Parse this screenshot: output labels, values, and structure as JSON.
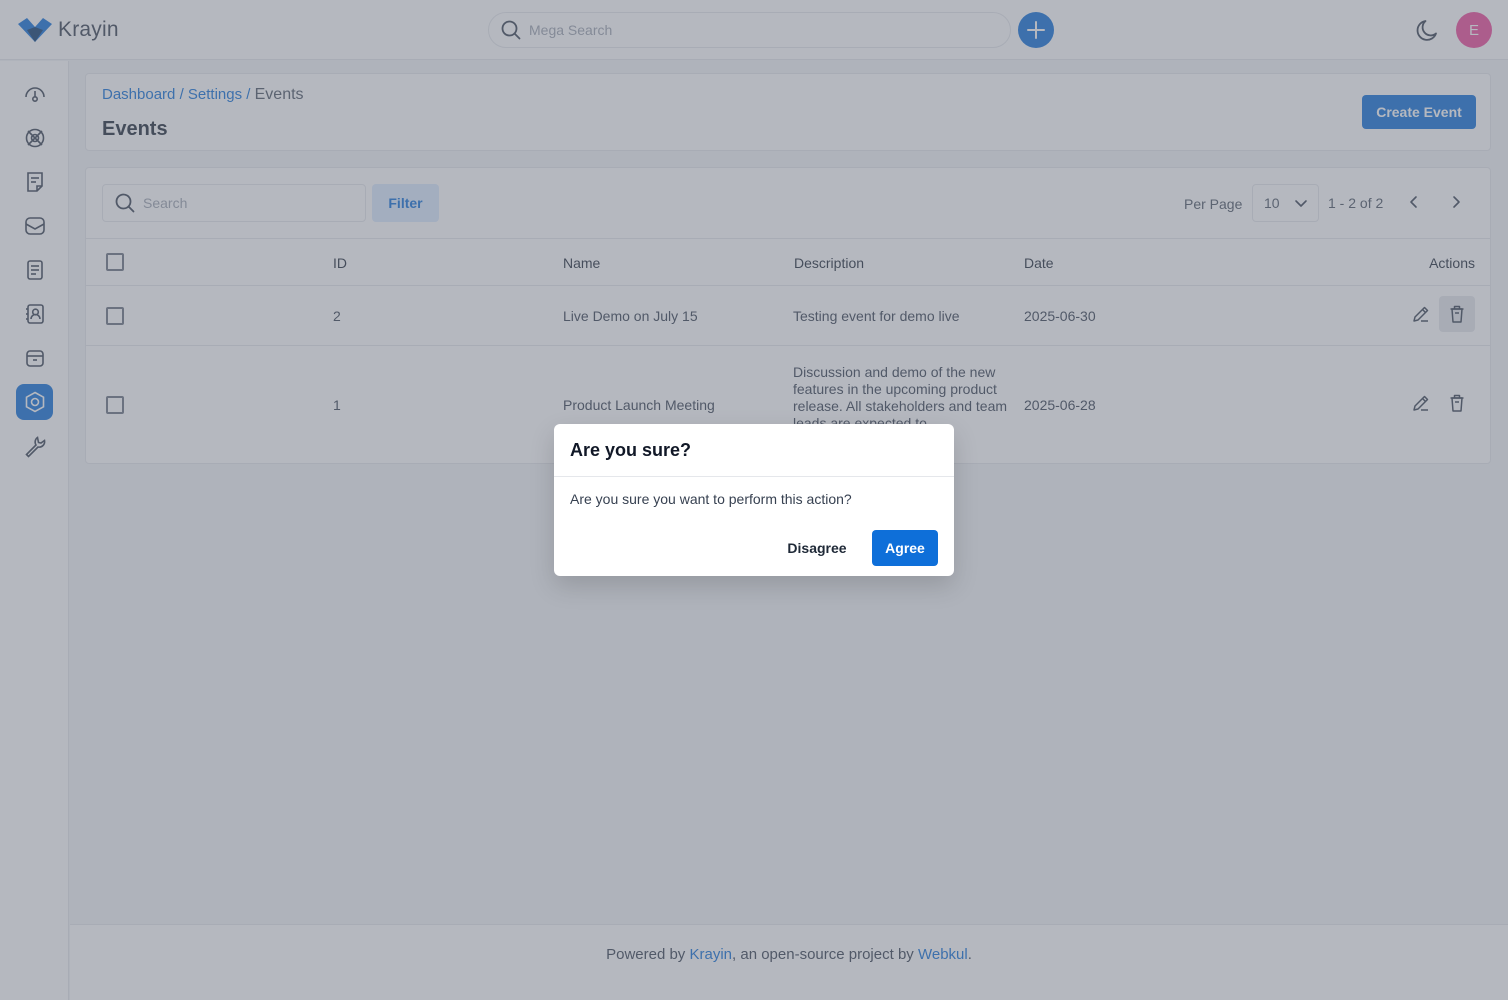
{
  "header": {
    "logo_text": "Krayin",
    "mega_search_placeholder": "Mega Search",
    "avatar_initial": "E"
  },
  "sidebar": {
    "items": [
      {
        "name": "dashboard"
      },
      {
        "name": "leads"
      },
      {
        "name": "quotes"
      },
      {
        "name": "mail"
      },
      {
        "name": "activities"
      },
      {
        "name": "contacts"
      },
      {
        "name": "products"
      },
      {
        "name": "settings",
        "active": true
      },
      {
        "name": "configuration"
      }
    ]
  },
  "breadcrumb": {
    "dashboard": "Dashboard",
    "settings": "Settings",
    "current": "Events",
    "sep": "/"
  },
  "page": {
    "title": "Events",
    "create_button": "Create Event"
  },
  "toolbar": {
    "search_placeholder": "Search",
    "filter_label": "Filter",
    "per_page_label": "Per Page",
    "per_page_value": "10",
    "page_info": "1 - 2 of 2"
  },
  "table": {
    "columns": {
      "id": "ID",
      "name": "Name",
      "description": "Description",
      "date": "Date",
      "actions": "Actions"
    },
    "rows": [
      {
        "id": "2",
        "name": "Live Demo on July 15",
        "description": "Testing event for demo live",
        "date": "2025-06-30"
      },
      {
        "id": "1",
        "name": "Product Launch Meeting",
        "description": "Discussion and demo of the new features in the upcoming product release. All stakeholders and team leads are expected to",
        "date": "2025-06-28"
      }
    ]
  },
  "footer": {
    "prefix": "Powered by ",
    "krayin_link": "Krayin",
    "middle": ", an open-source project by ",
    "webkul_link": "Webkul",
    "suffix": "."
  },
  "modal": {
    "title": "Are you sure?",
    "body": "Are you sure you want to perform this action?",
    "disagree": "Disagree",
    "agree": "Agree"
  },
  "colors": {
    "accent": "#0e6fd9",
    "avatar": "#ec4899"
  }
}
